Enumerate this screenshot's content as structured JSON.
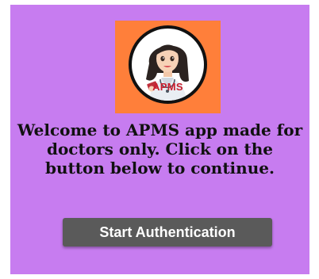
{
  "logo": {
    "label": "APMS",
    "icon": "doctor-avatar-icon",
    "background_color": "#ff7f3a",
    "label_color": "#c81e2e"
  },
  "welcome": {
    "text": "Welcome to APMS app made for doctors only. Click on the button below to continue."
  },
  "actions": {
    "start_label": "Start Authentication"
  },
  "colors": {
    "screen_background": "#c77cf0",
    "button_background": "#5a5a5a",
    "button_text": "#ffffff"
  }
}
